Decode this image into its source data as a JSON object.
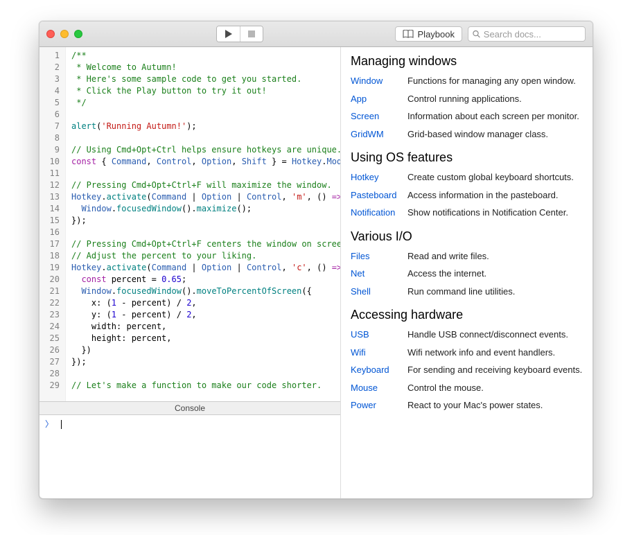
{
  "toolbar": {
    "playbook_label": "Playbook",
    "search_placeholder": "Search docs..."
  },
  "editor": {
    "lines": [
      {
        "n": 1,
        "tokens": [
          {
            "t": "/**",
            "c": "doc"
          }
        ]
      },
      {
        "n": 2,
        "tokens": [
          {
            "t": " * Welcome to Autumn!",
            "c": "doc"
          }
        ]
      },
      {
        "n": 3,
        "tokens": [
          {
            "t": " * Here's some sample code to get you started.",
            "c": "doc"
          }
        ]
      },
      {
        "n": 4,
        "tokens": [
          {
            "t": " * Click the Play button to try it out!",
            "c": "doc"
          }
        ]
      },
      {
        "n": 5,
        "tokens": [
          {
            "t": " */",
            "c": "doc"
          }
        ]
      },
      {
        "n": 6,
        "tokens": [
          {
            "t": "",
            "c": "plain"
          }
        ]
      },
      {
        "n": 7,
        "tokens": [
          {
            "t": "alert",
            "c": "fn"
          },
          {
            "t": "(",
            "c": "plain"
          },
          {
            "t": "'Running Autumn!'",
            "c": "str"
          },
          {
            "t": ");",
            "c": "plain"
          }
        ]
      },
      {
        "n": 8,
        "tokens": [
          {
            "t": "",
            "c": "plain"
          }
        ]
      },
      {
        "n": 9,
        "tokens": [
          {
            "t": "// Using Cmd+Opt+Ctrl helps ensure hotkeys are unique.",
            "c": "cmt"
          }
        ]
      },
      {
        "n": 10,
        "tokens": [
          {
            "t": "const",
            "c": "kw"
          },
          {
            "t": " { ",
            "c": "plain"
          },
          {
            "t": "Command",
            "c": "ident"
          },
          {
            "t": ", ",
            "c": "plain"
          },
          {
            "t": "Control",
            "c": "ident"
          },
          {
            "t": ", ",
            "c": "plain"
          },
          {
            "t": "Option",
            "c": "ident"
          },
          {
            "t": ", ",
            "c": "plain"
          },
          {
            "t": "Shift",
            "c": "ident"
          },
          {
            "t": " } = ",
            "c": "plain"
          },
          {
            "t": "Hotkey",
            "c": "ident"
          },
          {
            "t": ".",
            "c": "plain"
          },
          {
            "t": "Mods",
            "c": "ident"
          },
          {
            "t": ";",
            "c": "plain"
          }
        ]
      },
      {
        "n": 11,
        "tokens": [
          {
            "t": "",
            "c": "plain"
          }
        ]
      },
      {
        "n": 12,
        "tokens": [
          {
            "t": "// Pressing Cmd+Opt+Ctrl+F will maximize the window.",
            "c": "cmt"
          }
        ]
      },
      {
        "n": 13,
        "tokens": [
          {
            "t": "Hotkey",
            "c": "ident"
          },
          {
            "t": ".",
            "c": "plain"
          },
          {
            "t": "activate",
            "c": "fn"
          },
          {
            "t": "(",
            "c": "plain"
          },
          {
            "t": "Command",
            "c": "ident"
          },
          {
            "t": " | ",
            "c": "plain"
          },
          {
            "t": "Option",
            "c": "ident"
          },
          {
            "t": " | ",
            "c": "plain"
          },
          {
            "t": "Control",
            "c": "ident"
          },
          {
            "t": ", ",
            "c": "plain"
          },
          {
            "t": "'m'",
            "c": "str"
          },
          {
            "t": ", () ",
            "c": "plain"
          },
          {
            "t": "=>",
            "c": "kw"
          },
          {
            "t": " {",
            "c": "plain"
          }
        ]
      },
      {
        "n": 14,
        "tokens": [
          {
            "t": "  ",
            "c": "plain"
          },
          {
            "t": "Window",
            "c": "ident"
          },
          {
            "t": ".",
            "c": "plain"
          },
          {
            "t": "focusedWindow",
            "c": "fn"
          },
          {
            "t": "().",
            "c": "plain"
          },
          {
            "t": "maximize",
            "c": "fn"
          },
          {
            "t": "();",
            "c": "plain"
          }
        ]
      },
      {
        "n": 15,
        "tokens": [
          {
            "t": "});",
            "c": "plain"
          }
        ]
      },
      {
        "n": 16,
        "tokens": [
          {
            "t": "",
            "c": "plain"
          }
        ]
      },
      {
        "n": 17,
        "tokens": [
          {
            "t": "// Pressing Cmd+Opt+Ctrl+F centers the window on screen.",
            "c": "cmt"
          }
        ]
      },
      {
        "n": 18,
        "tokens": [
          {
            "t": "// Adjust the percent to your liking.",
            "c": "cmt"
          }
        ]
      },
      {
        "n": 19,
        "tokens": [
          {
            "t": "Hotkey",
            "c": "ident"
          },
          {
            "t": ".",
            "c": "plain"
          },
          {
            "t": "activate",
            "c": "fn"
          },
          {
            "t": "(",
            "c": "plain"
          },
          {
            "t": "Command",
            "c": "ident"
          },
          {
            "t": " | ",
            "c": "plain"
          },
          {
            "t": "Option",
            "c": "ident"
          },
          {
            "t": " | ",
            "c": "plain"
          },
          {
            "t": "Control",
            "c": "ident"
          },
          {
            "t": ", ",
            "c": "plain"
          },
          {
            "t": "'c'",
            "c": "str"
          },
          {
            "t": ", () ",
            "c": "plain"
          },
          {
            "t": "=>",
            "c": "kw"
          },
          {
            "t": " {",
            "c": "plain"
          }
        ]
      },
      {
        "n": 20,
        "tokens": [
          {
            "t": "  ",
            "c": "plain"
          },
          {
            "t": "const",
            "c": "kw"
          },
          {
            "t": " percent = ",
            "c": "plain"
          },
          {
            "t": "0.65",
            "c": "num"
          },
          {
            "t": ";",
            "c": "plain"
          }
        ]
      },
      {
        "n": 21,
        "tokens": [
          {
            "t": "  ",
            "c": "plain"
          },
          {
            "t": "Window",
            "c": "ident"
          },
          {
            "t": ".",
            "c": "plain"
          },
          {
            "t": "focusedWindow",
            "c": "fn"
          },
          {
            "t": "().",
            "c": "plain"
          },
          {
            "t": "moveToPercentOfScreen",
            "c": "fn"
          },
          {
            "t": "({",
            "c": "plain"
          }
        ]
      },
      {
        "n": 22,
        "tokens": [
          {
            "t": "    x: (",
            "c": "plain"
          },
          {
            "t": "1",
            "c": "num"
          },
          {
            "t": " - percent) / ",
            "c": "plain"
          },
          {
            "t": "2",
            "c": "num"
          },
          {
            "t": ",",
            "c": "plain"
          }
        ]
      },
      {
        "n": 23,
        "tokens": [
          {
            "t": "    y: (",
            "c": "plain"
          },
          {
            "t": "1",
            "c": "num"
          },
          {
            "t": " - percent) / ",
            "c": "plain"
          },
          {
            "t": "2",
            "c": "num"
          },
          {
            "t": ",",
            "c": "plain"
          }
        ]
      },
      {
        "n": 24,
        "tokens": [
          {
            "t": "    width: percent,",
            "c": "plain"
          }
        ]
      },
      {
        "n": 25,
        "tokens": [
          {
            "t": "    height: percent,",
            "c": "plain"
          }
        ]
      },
      {
        "n": 26,
        "tokens": [
          {
            "t": "  })",
            "c": "plain"
          }
        ]
      },
      {
        "n": 27,
        "tokens": [
          {
            "t": "});",
            "c": "plain"
          }
        ]
      },
      {
        "n": 28,
        "tokens": [
          {
            "t": "",
            "c": "plain"
          }
        ]
      },
      {
        "n": 29,
        "tokens": [
          {
            "t": "// Let's make a function to make our code shorter.",
            "c": "cmt"
          }
        ]
      }
    ]
  },
  "console": {
    "header": "Console",
    "prompt": "〉"
  },
  "docs": {
    "sections": [
      {
        "title": "Managing windows",
        "items": [
          {
            "name": "Window",
            "desc": "Functions for managing any open window."
          },
          {
            "name": "App",
            "desc": "Control running applications."
          },
          {
            "name": "Screen",
            "desc": "Information about each screen per monitor."
          },
          {
            "name": "GridWM",
            "desc": "Grid-based window manager class."
          }
        ]
      },
      {
        "title": "Using OS features",
        "items": [
          {
            "name": "Hotkey",
            "desc": "Create custom global keyboard shortcuts."
          },
          {
            "name": "Pasteboard",
            "desc": "Access information in the pasteboard."
          },
          {
            "name": "Notification",
            "desc": "Show notifications in Notification Center."
          }
        ]
      },
      {
        "title": "Various I/O",
        "items": [
          {
            "name": "Files",
            "desc": "Read and write files."
          },
          {
            "name": "Net",
            "desc": "Access the internet."
          },
          {
            "name": "Shell",
            "desc": "Run command line utilities."
          }
        ]
      },
      {
        "title": "Accessing hardware",
        "items": [
          {
            "name": "USB",
            "desc": "Handle USB connect/disconnect events."
          },
          {
            "name": "Wifi",
            "desc": "Wifi network info and event handlers."
          },
          {
            "name": "Keyboard",
            "desc": "For sending and receiving keyboard events."
          },
          {
            "name": "Mouse",
            "desc": "Control the mouse."
          },
          {
            "name": "Power",
            "desc": "React to your Mac's power states."
          }
        ]
      }
    ]
  }
}
